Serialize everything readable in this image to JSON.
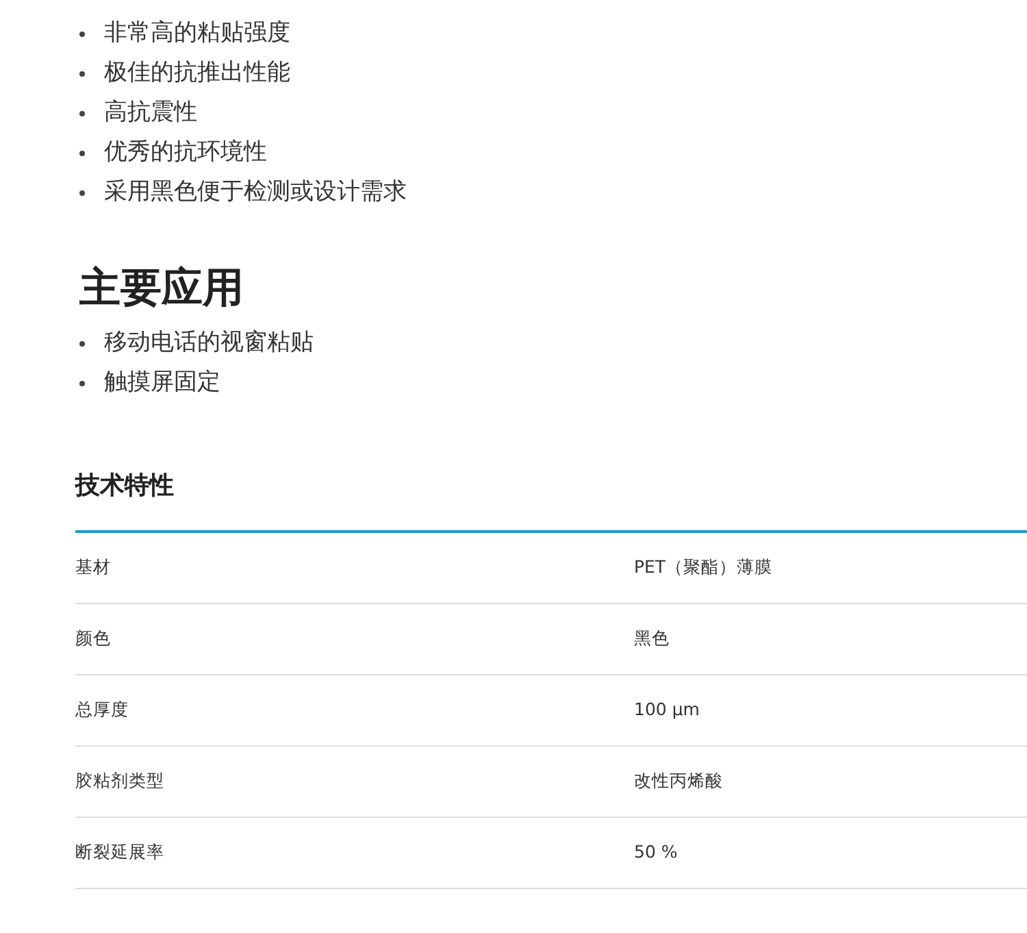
{
  "features": [
    "非常高的粘贴强度",
    "极佳的抗推出性能",
    "高抗震性",
    "优秀的抗环境性",
    "采用黑色便于检测或设计需求"
  ],
  "applications": {
    "title": "主要应用",
    "items": [
      "移动电话的视窗粘贴",
      "触摸屏固定"
    ]
  },
  "specs": {
    "title": "技术特性",
    "rows": [
      {
        "label": "基材",
        "value": "PET（聚酯）薄膜"
      },
      {
        "label": "颜色",
        "value": "黑色"
      },
      {
        "label": "总厚度",
        "value": "100 µm"
      },
      {
        "label": "胶粘剂类型",
        "value": "改性丙烯酸"
      },
      {
        "label": "断裂延展率",
        "value": "50 %"
      }
    ]
  }
}
